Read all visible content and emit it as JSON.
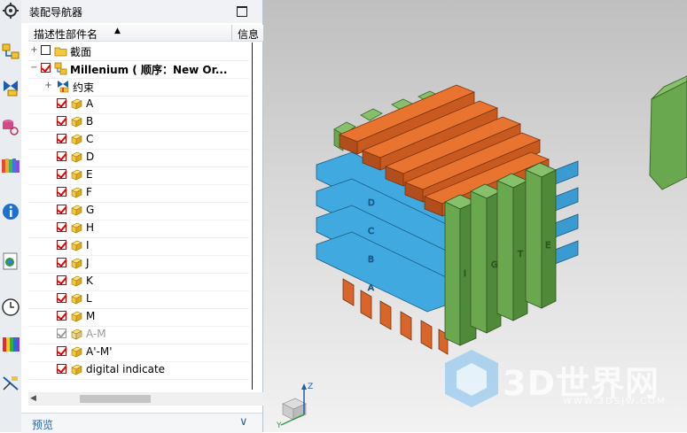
{
  "navigator": {
    "title": "装配导航器",
    "columns": [
      "描述性部件名",
      "信息"
    ],
    "rows": [
      {
        "label": "截面",
        "type": "folder",
        "expander": "+",
        "check": "empty"
      },
      {
        "label": "Millenium ( 顺序：New Or...",
        "type": "assembly",
        "expander": "−",
        "check": "checked",
        "bold": true
      },
      {
        "label": "约束",
        "type": "constraint",
        "expander": "+",
        "check": "none"
      },
      {
        "label": "A",
        "type": "part",
        "check": "checked"
      },
      {
        "label": "B",
        "type": "part",
        "check": "checked"
      },
      {
        "label": "C",
        "type": "part",
        "check": "checked"
      },
      {
        "label": "D",
        "type": "part",
        "check": "checked"
      },
      {
        "label": "E",
        "type": "part",
        "check": "checked"
      },
      {
        "label": "F",
        "type": "part",
        "check": "checked"
      },
      {
        "label": "G",
        "type": "part",
        "check": "checked"
      },
      {
        "label": "H",
        "type": "part",
        "check": "checked"
      },
      {
        "label": "I",
        "type": "part",
        "check": "checked"
      },
      {
        "label": "J",
        "type": "part",
        "check": "checked"
      },
      {
        "label": "K",
        "type": "part",
        "check": "checked"
      },
      {
        "label": "L",
        "type": "part",
        "check": "checked"
      },
      {
        "label": "M",
        "type": "part",
        "check": "checked"
      },
      {
        "label": "A-M",
        "type": "part",
        "check": "grey",
        "grey": true
      },
      {
        "label": "A'-M'",
        "type": "part",
        "check": "checked"
      },
      {
        "label": "digital indicate",
        "type": "part",
        "check": "checked"
      }
    ],
    "preview_label": "预览"
  },
  "viewport": {
    "watermark_text": "3D世界网",
    "watermark_url": "WWW.3DSJW.COM",
    "triad_labels": {
      "z": "Z",
      "y": "Y"
    }
  },
  "colors": {
    "orange": "#e8742f",
    "blue": "#3fa9e0",
    "green": "#6aa84f",
    "orange_dark": "#b24e1b",
    "blue_dark": "#2a7bb0",
    "green_dark": "#4a7a34"
  },
  "resource_bar_icons": [
    "gear-icon",
    "assembly-navigator-icon",
    "constraint-navigator-icon",
    "part-navigator-icon",
    "reuse-library-icon",
    "info-icon",
    "web-browser-icon",
    "history-icon",
    "palette-icon",
    "process-icon"
  ]
}
